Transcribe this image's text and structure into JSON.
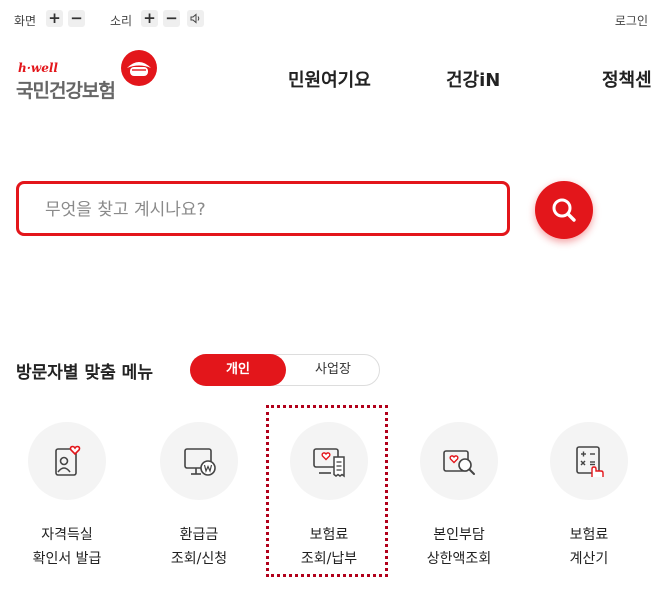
{
  "utility": {
    "screen_label": "화면",
    "sound_label": "소리",
    "plus": "+",
    "minus": "−",
    "login": "로그인"
  },
  "logo": {
    "en": "h·well",
    "ko": "국민건강보험"
  },
  "gnb": [
    "민원여기요",
    "건강iN",
    "정책센"
  ],
  "search": {
    "placeholder": "무엇을 찾고 계시나요?"
  },
  "visitor_menu": {
    "title": "방문자별 맞춤 메뉴",
    "tabs": [
      {
        "label": "개인",
        "active": true
      },
      {
        "label": "사업장",
        "active": false
      }
    ],
    "items": [
      {
        "icon": "id-card-heart-icon",
        "line1": "자격득실",
        "line2": "확인서 발급"
      },
      {
        "icon": "monitor-won-icon",
        "line1": "환급금",
        "line2": "조회/신청"
      },
      {
        "icon": "receipt-monitor-icon",
        "line1": "보험료",
        "line2": "조회/납부"
      },
      {
        "icon": "heart-search-icon",
        "line1": "본인부담",
        "line2": "상한액조회"
      },
      {
        "icon": "calculator-hand-icon",
        "line1": "보험료",
        "line2": "계산기"
      }
    ]
  },
  "colors": {
    "accent": "#e3161b",
    "highlight_border": "#b1001a"
  }
}
